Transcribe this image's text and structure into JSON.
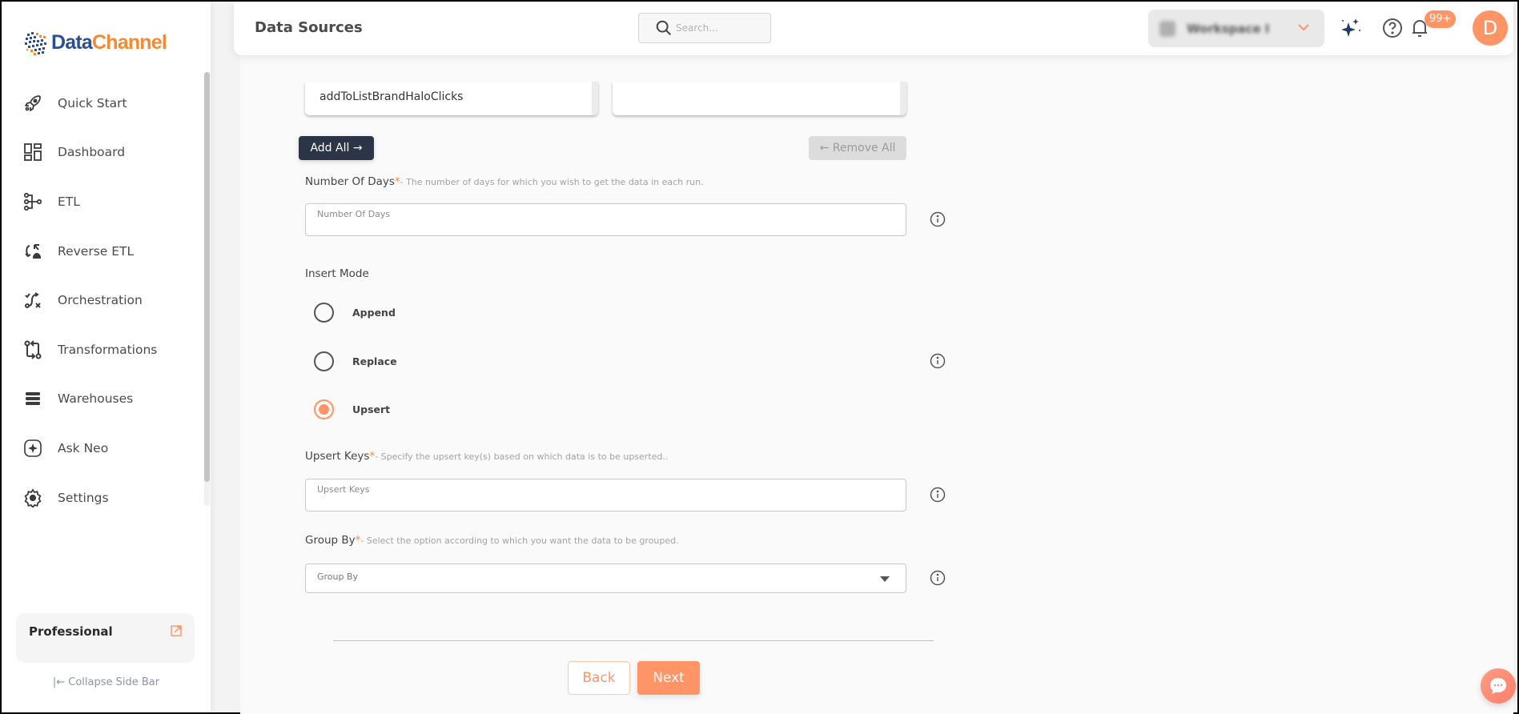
{
  "brand": {
    "name_part1": "Data",
    "name_part2": "Channel",
    "color_primary": "#2e4f8f",
    "color_accent": "#f58a35"
  },
  "sidebar": {
    "items": [
      {
        "label": "Quick Start",
        "icon": "rocket-icon"
      },
      {
        "label": "Dashboard",
        "icon": "dashboard-icon"
      },
      {
        "label": "ETL",
        "icon": "etl-icon"
      },
      {
        "label": "Reverse ETL",
        "icon": "reverse-etl-icon"
      },
      {
        "label": "Orchestration",
        "icon": "orchestration-icon"
      },
      {
        "label": "Transformations",
        "icon": "transformations-icon"
      },
      {
        "label": "Warehouses",
        "icon": "warehouses-icon"
      },
      {
        "label": "Ask Neo",
        "icon": "ask-neo-icon"
      },
      {
        "label": "Settings",
        "icon": "gear-icon"
      }
    ],
    "plan": {
      "name": "Professional",
      "icon": "external-link-icon"
    },
    "collapse_label": "|← Collapse Side Bar"
  },
  "header": {
    "title": "Data Sources",
    "search_placeholder": "Search...",
    "workspace_name": "Workspace I",
    "notification_count": "99+",
    "avatar_initial": "D",
    "accent_color": "#ff9466"
  },
  "form": {
    "available_list": [
      "addToListBrandHaloClicks"
    ],
    "selected_list": [],
    "add_all_label": "Add All →",
    "remove_all_label": "← Remove All",
    "number_of_days": {
      "label": "Number Of Days",
      "required": "*",
      "hint": "- The number of days for which you wish to get the data in each run.",
      "placeholder": "Number Of Days",
      "value": ""
    },
    "insert_mode": {
      "label": "Insert Mode",
      "options": [
        {
          "label": "Append",
          "selected": false
        },
        {
          "label": "Replace",
          "selected": false
        },
        {
          "label": "Upsert",
          "selected": true
        }
      ]
    },
    "upsert_keys": {
      "label": "Upsert Keys",
      "required": "*",
      "hint": "- Specify the upsert key(s) based on which data is to be upserted..",
      "placeholder": "Upsert Keys",
      "value": ""
    },
    "group_by": {
      "label": "Group By",
      "required": "*",
      "hint": "- Select the option according to which you want the data to be grouped.",
      "placeholder": "Group By"
    },
    "back_label": "Back",
    "next_label": "Next"
  }
}
